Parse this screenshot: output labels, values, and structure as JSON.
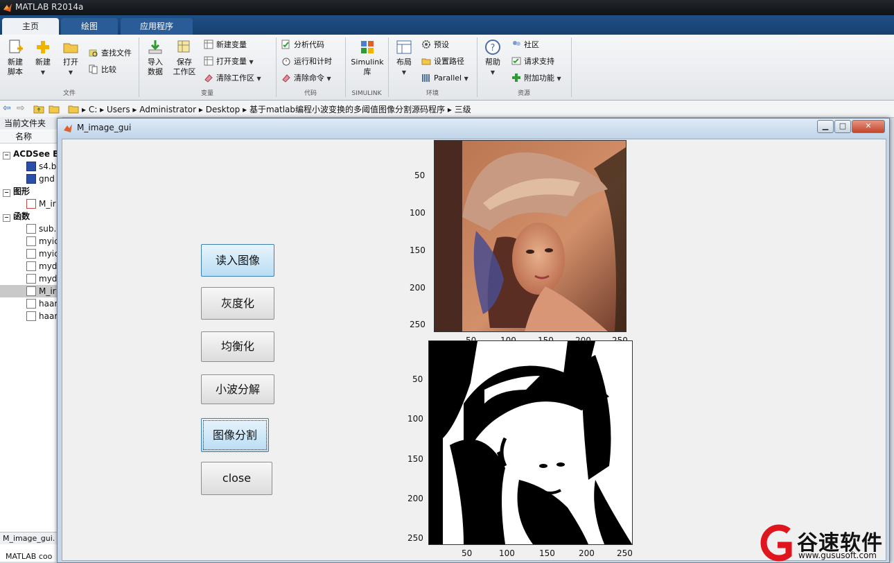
{
  "app": {
    "title": "MATLAB R2014a"
  },
  "ribbon_tabs": [
    {
      "label": "主页",
      "active": true
    },
    {
      "label": "绘图",
      "active": false
    },
    {
      "label": "应用程序",
      "active": false
    }
  ],
  "ribbon": {
    "file": {
      "new_script": "新建\n脚本",
      "new": "新建",
      "open": "打开",
      "find_files": "查找文件",
      "compare": "比较",
      "group": "文件"
    },
    "variable": {
      "import": "导入\n数据",
      "save_ws": "保存\n工作区",
      "new_var": "新建变量",
      "open_var": "打开变量",
      "clear_ws": "清除工作区",
      "group": "变量"
    },
    "code": {
      "analyze": "分析代码",
      "run_time": "运行和计时",
      "clear_cmd": "清除命令",
      "group": "代码"
    },
    "simulink": {
      "lib": "Simulink\n库",
      "group": "SIMULINK"
    },
    "env": {
      "layout": "布局",
      "prefs": "预设",
      "set_path": "设置路径",
      "parallel": "Parallel",
      "group": "环境"
    },
    "resources": {
      "help": "帮助",
      "community": "社区",
      "support": "请求支持",
      "addons": "附加功能",
      "group": "资源"
    }
  },
  "address": {
    "crumbs": [
      "C:",
      "Users",
      "Administrator",
      "Desktop",
      "基于matlab编程小波变换的多阈值图像分割源码程序",
      "三级"
    ]
  },
  "left_panel": {
    "title": "当前文件夹",
    "col_name": "名称",
    "groups": [
      {
        "label": "ACDSee BI",
        "items": [
          {
            "name": "s4.b",
            "type": "bmp"
          },
          {
            "name": "gnd",
            "type": "bmp"
          }
        ]
      },
      {
        "label": "图形",
        "items": [
          {
            "name": "M_ir",
            "type": "fig"
          }
        ]
      },
      {
        "label": "函数",
        "items": [
          {
            "name": "sub.",
            "type": "m"
          },
          {
            "name": "myic",
            "type": "m"
          },
          {
            "name": "myic",
            "type": "m"
          },
          {
            "name": "myd",
            "type": "m"
          },
          {
            "name": "myd",
            "type": "m"
          },
          {
            "name": "M_ir",
            "type": "m",
            "highlighted": true
          },
          {
            "name": "haar",
            "type": "m"
          },
          {
            "name": "haar",
            "type": "m"
          }
        ]
      }
    ],
    "detail_file": "M_image_gui.",
    "status": "MATLAB coo"
  },
  "gui": {
    "title": "M_image_gui",
    "buttons": [
      {
        "label": "读入图像"
      },
      {
        "label": "灰度化"
      },
      {
        "label": "均衡化"
      },
      {
        "label": "小波分解"
      },
      {
        "label": "图像分割"
      },
      {
        "label": "close"
      }
    ],
    "axes_top": {
      "yticks": [
        "50",
        "100",
        "150",
        "200",
        "250"
      ],
      "xticks": [
        "50",
        "100",
        "150",
        "200",
        "250"
      ]
    },
    "axes_bottom": {
      "yticks": [
        "50",
        "100",
        "150",
        "200",
        "250"
      ],
      "xticks": [
        "50",
        "100",
        "150",
        "200",
        "250"
      ]
    }
  },
  "watermark": {
    "brand": "谷速软件",
    "url": "www.gususoft.com"
  }
}
